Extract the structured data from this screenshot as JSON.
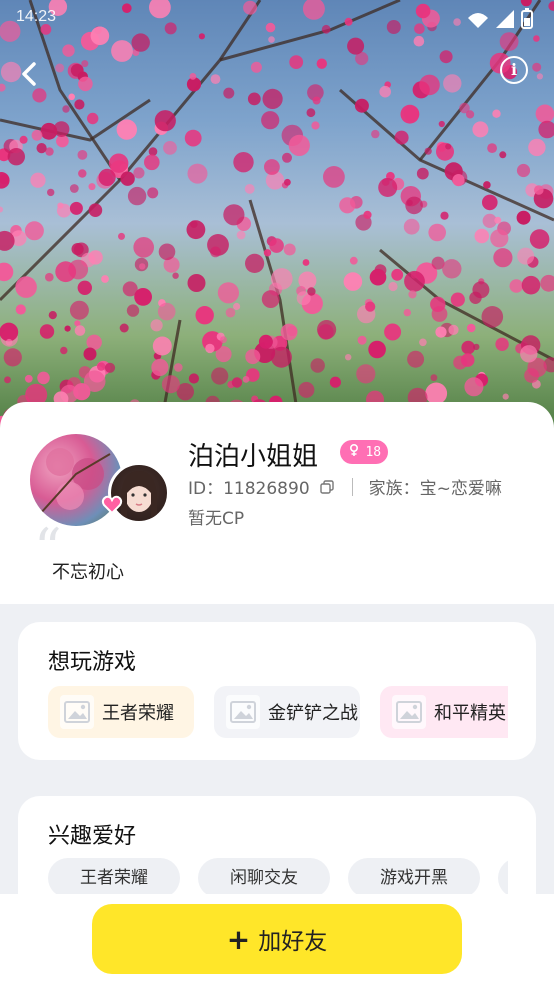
{
  "status_bar": {
    "time": "14:23"
  },
  "header": {
    "back_icon": "chevron-left-icon",
    "info_icon": "info-icon",
    "info_glyph": "i"
  },
  "profile": {
    "name": "泊泊小姐姐",
    "badge_icon": "gender-female-icon",
    "level": "18",
    "id_label": "ID：11826890",
    "family_label": "家族：宝~恋爱嘛",
    "cp_text": "暂无CP",
    "signature": "不忘初心"
  },
  "games": {
    "title": "想玩游戏",
    "items": [
      {
        "label": "王者荣耀",
        "bg": "#fff5e4"
      },
      {
        "label": "金铲铲之战",
        "bg": "#f2f3f7"
      },
      {
        "label": "和平精英",
        "bg": "#ffe8f3"
      }
    ]
  },
  "hobbies": {
    "title": "兴趣爱好",
    "items": [
      "王者荣耀",
      "闲聊交友",
      "游戏开黑"
    ]
  },
  "footer": {
    "add_friend_label": "加好友",
    "add_icon": "plus-icon"
  },
  "colors": {
    "accent_yellow": "#ffe629",
    "badge_pink": "#ff6fb4",
    "page_bg": "#eef0f4"
  }
}
